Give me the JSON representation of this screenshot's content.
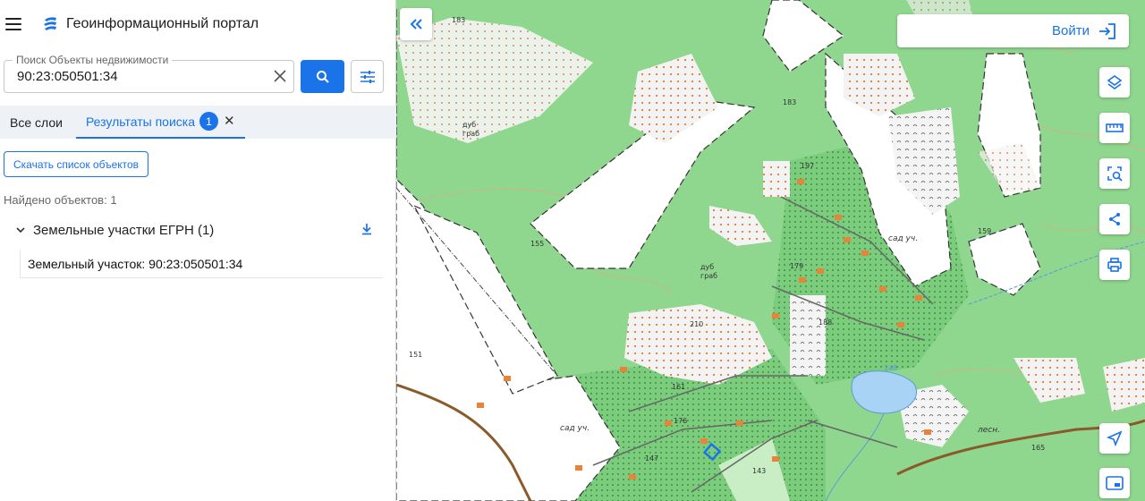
{
  "header": {
    "title": "Геоинформационный портал"
  },
  "search": {
    "legend": "Поиск Объекты недвижимости",
    "value": "90:23:050501:34"
  },
  "tabs": [
    {
      "label": "Все слои"
    },
    {
      "label": "Результаты поиска",
      "badge": "1"
    }
  ],
  "results": {
    "download_button": "Скачать список объектов",
    "found_text": "Найдено объектов: 1",
    "group_label": "Земельные участки ЕГРН (1)",
    "items": [
      {
        "label": "Земельный участок: 90:23:050501:34"
      }
    ]
  },
  "map": {
    "login_label": "Войти",
    "labels": {
      "l183a": "183",
      "l183b": "183",
      "l197": "197",
      "l155": "155",
      "l159": "159",
      "l179": "179",
      "l188": "188",
      "l210": "210",
      "l151": "151",
      "l161": "161",
      "l176": "176",
      "l147": "147",
      "l143": "143",
      "l165": "165",
      "l148": "148",
      "dub1": "дуб",
      "grab1": "граб",
      "dub2": "дуб",
      "grab2": "граб",
      "sad1": "сад уч.",
      "sad2": "сад уч.",
      "lesn": "лесн."
    },
    "tools": [
      "layers-icon",
      "ruler-icon",
      "area-select-icon",
      "share-icon",
      "print-icon",
      "locate-icon",
      "minimap-icon"
    ]
  },
  "colors": {
    "accent": "#1a73e8",
    "forest": "#8fd68f",
    "dense_forest": "#5fbf6b",
    "water": "#a9d3f5",
    "building": "#e8843a"
  }
}
